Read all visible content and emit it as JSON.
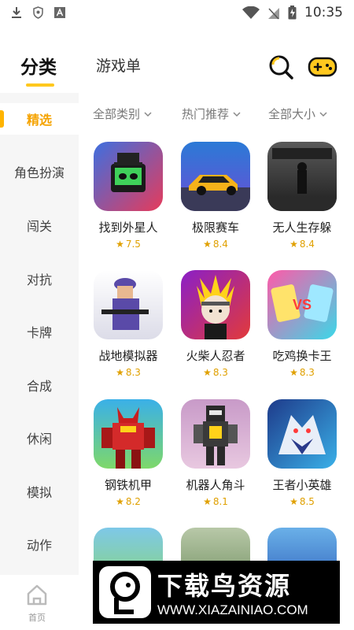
{
  "status_bar": {
    "time": "10:35",
    "icons": [
      "download-icon",
      "shield-icon",
      "font-icon",
      "wifi-icon",
      "signal-off-icon",
      "battery-charging-icon"
    ]
  },
  "header": {
    "active_tab": "分类",
    "inactive_tab": "游戏单",
    "search_icon": "search-icon",
    "game_icon": "gamepad-icon",
    "accent_color": "#ffc81e"
  },
  "sidebar": {
    "items": [
      {
        "label": "精选",
        "active": true
      },
      {
        "label": "角色扮演",
        "active": false
      },
      {
        "label": "闯关",
        "active": false
      },
      {
        "label": "对抗",
        "active": false
      },
      {
        "label": "卡牌",
        "active": false
      },
      {
        "label": "合成",
        "active": false
      },
      {
        "label": "休闲",
        "active": false
      },
      {
        "label": "模拟",
        "active": false
      },
      {
        "label": "动作",
        "active": false
      }
    ]
  },
  "filters": [
    {
      "label": "全部类别"
    },
    {
      "label": "热门推荐"
    },
    {
      "label": "全部大小"
    }
  ],
  "games": [
    {
      "name": "找到外星人",
      "rating": "7.5"
    },
    {
      "name": "极限赛车",
      "rating": "8.4"
    },
    {
      "name": "无人生存躲",
      "rating": "8.4"
    },
    {
      "name": "战地模拟器",
      "rating": "8.3"
    },
    {
      "name": "火柴人忍者",
      "rating": "8.3"
    },
    {
      "name": "吃鸡换卡王",
      "rating": "8.3"
    },
    {
      "name": "钢铁机甲",
      "rating": "8.2"
    },
    {
      "name": "机器人角斗",
      "rating": "8.1"
    },
    {
      "name": "王者小英雄",
      "rating": "8.5"
    }
  ],
  "bottom_nav": {
    "home_label": "首页"
  },
  "watermark": {
    "title": "下载鸟资源",
    "url": "WWW.XIAZAINIAO.COM"
  }
}
